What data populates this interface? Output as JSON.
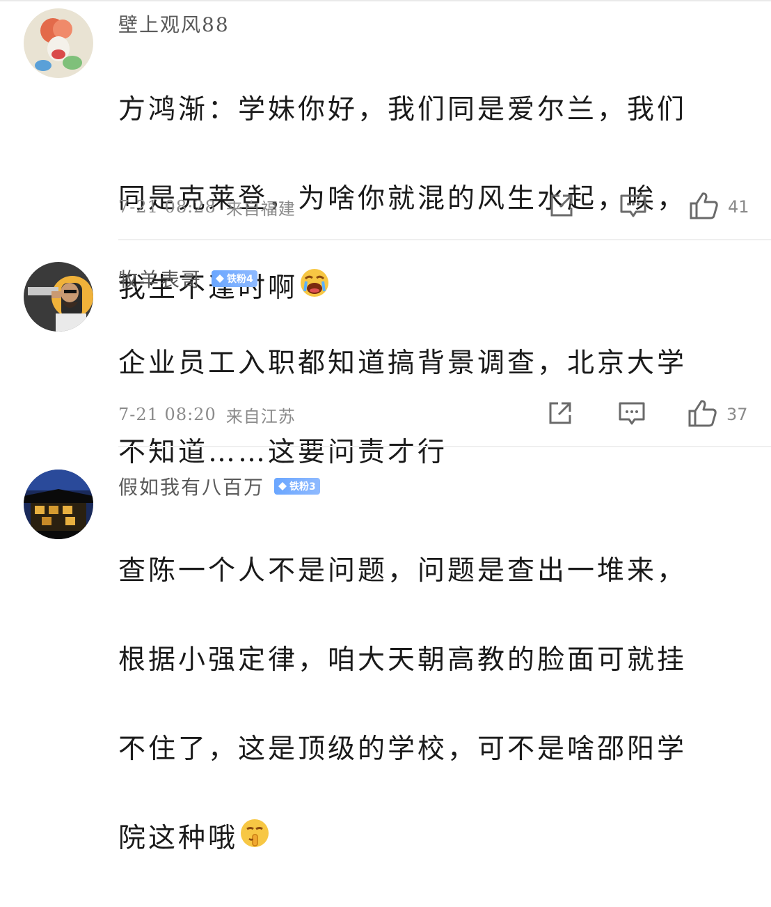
{
  "comments": [
    {
      "username": "壁上观风88",
      "badge": "",
      "lines": [
        "方鸿渐：学妹你好，我们同是爱尔兰，我们",
        "同是克莱登，为啥你就混的风生水起，唉，",
        "我生不逢时啊"
      ],
      "emoji": "crying-face",
      "time": "7-21 08:28",
      "location": "来自福建",
      "likes": "41"
    },
    {
      "username": "牧羊表哥",
      "badge": "铁粉4",
      "lines": [
        "企业员工入职都知道搞背景调查，北京大学",
        "不知道……这要问责才行"
      ],
      "emoji": "",
      "time": "7-21 08:20",
      "location": "来自江苏",
      "likes": "37"
    },
    {
      "username": "假如我有八百万",
      "badge": "铁粉3",
      "lines": [
        "查陈一个人不是问题，问题是查出一堆来，",
        "根据小强定律，咱大天朝高教的脸面可就挂",
        "不住了，这是顶级的学校，可不是啥邵阳学",
        "院这种哦"
      ],
      "emoji": "shushing-face",
      "time": "",
      "location": "",
      "likes": ""
    }
  ],
  "icons": {
    "share": "share-icon",
    "reply": "comment-icon",
    "like": "thumbs-up-icon"
  },
  "colors": {
    "badge": "#6aa6ff",
    "meta_text": "#8a8a8a",
    "username_text": "#5a5a5a"
  }
}
